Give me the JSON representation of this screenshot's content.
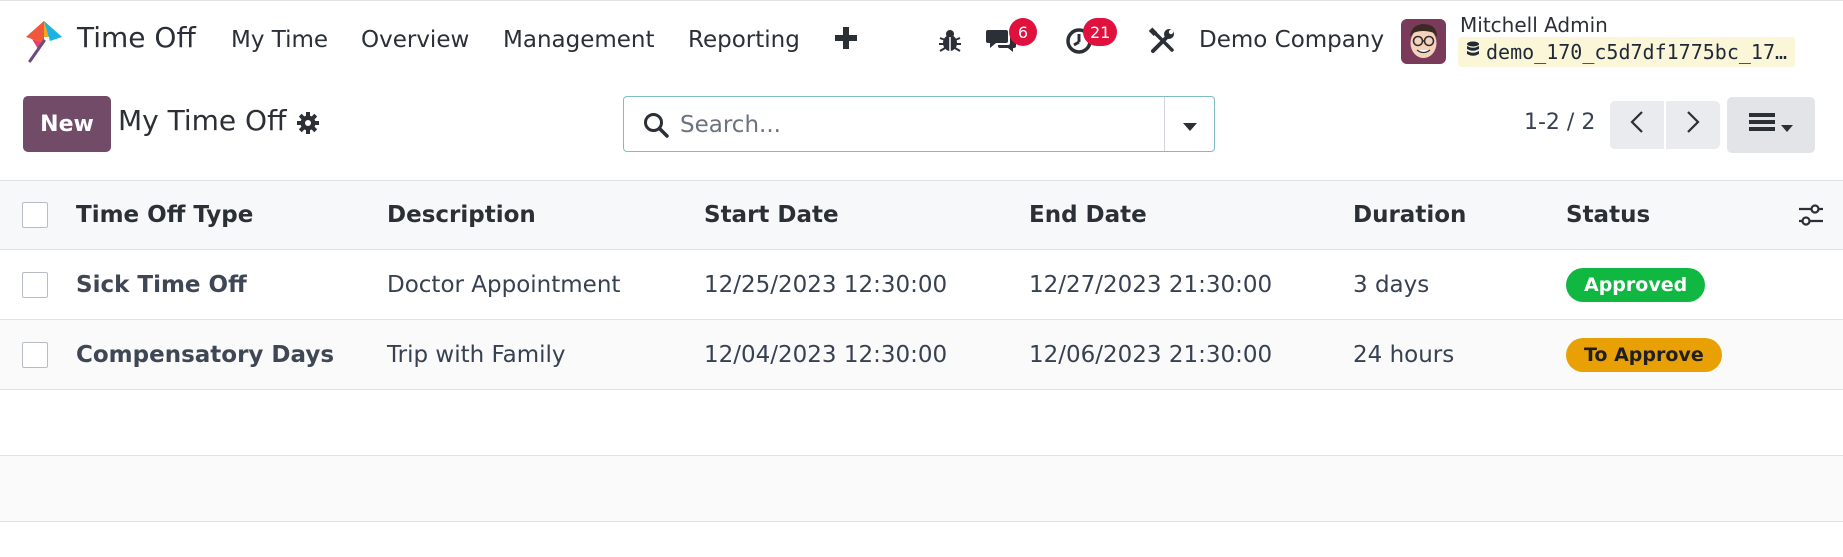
{
  "navbar": {
    "app_title": "Time Off",
    "menu": [
      "My Time",
      "Overview",
      "Management",
      "Reporting"
    ],
    "messages_count": "6",
    "activities_count": "21",
    "company": "Demo Company",
    "user_name": "Mitchell Admin",
    "database": "demo_170_c5d7df1775bc_17…"
  },
  "control_panel": {
    "new_label": "New",
    "title": "My Time Off",
    "search_placeholder": "Search...",
    "pager": "1-2 / 2"
  },
  "table": {
    "columns": [
      "Time Off Type",
      "Description",
      "Start Date",
      "End Date",
      "Duration",
      "Status"
    ],
    "rows": [
      {
        "type": "Sick Time Off",
        "description": "Doctor Appointment",
        "start": "12/25/2023 12:30:00",
        "end": "12/27/2023 21:30:00",
        "duration": "3 days",
        "status": "Approved"
      },
      {
        "type": "Compensatory Days",
        "description": "Trip with Family",
        "start": "12/04/2023 12:30:00",
        "end": "12/06/2023 21:30:00",
        "duration": "24 hours",
        "status": "To Approve"
      }
    ]
  },
  "colors": {
    "primary": "#714b67",
    "approved_bg": "#10b842",
    "approved_text": "#ffffff",
    "to_approve_bg": "#e9a005",
    "to_approve_text": "#1f1f1f",
    "badge": "#e0113d"
  },
  "icons": [
    "app-logo-icon",
    "plus-icon",
    "bug-icon",
    "chat-icon",
    "clock-icon",
    "tools-icon",
    "database-icon",
    "gear-icon",
    "search-icon",
    "caret-down-icon",
    "chevron-left-icon",
    "chevron-right-icon",
    "list-view-icon",
    "optional-columns-icon"
  ]
}
